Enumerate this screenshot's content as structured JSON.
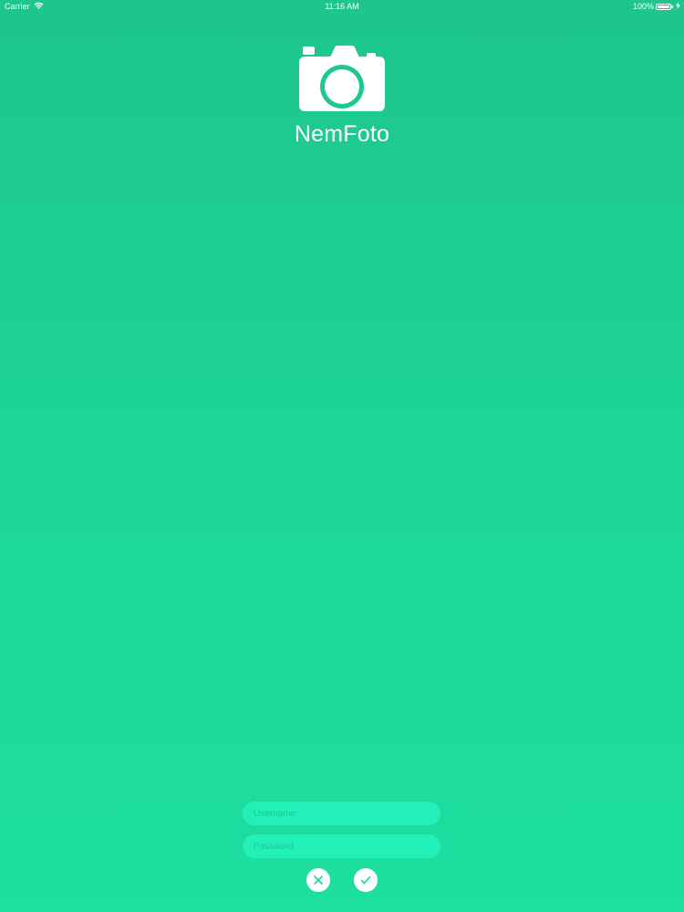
{
  "status_bar": {
    "carrier": "Carrier",
    "time": "11:16 AM",
    "battery": "100%"
  },
  "app": {
    "title": "NemFoto",
    "logo_icon": "camera-icon"
  },
  "login": {
    "username_placeholder": "Username",
    "username_value": "",
    "password_placeholder": "Password",
    "password_value": "",
    "cancel_icon": "close-icon",
    "confirm_icon": "checkmark-icon"
  },
  "colors": {
    "background_top": "#1dc68b",
    "background_bottom": "#1ddf9f",
    "field_fill": "#22f0b8",
    "text": "#ffffff"
  }
}
